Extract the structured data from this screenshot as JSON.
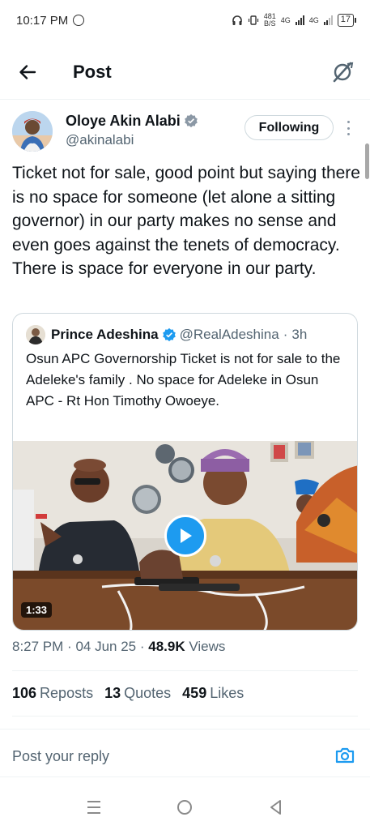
{
  "status_bar": {
    "time": "10:17 PM",
    "net_speed": "481",
    "net_unit": "B/S",
    "network_1": "4G",
    "network_2": "4G",
    "battery": "17"
  },
  "header": {
    "title": "Post",
    "back_icon": "arrow-left-icon",
    "grok_icon": "grok-icon"
  },
  "post": {
    "author_name": "Oloye Akin Alabi",
    "author_handle": "@akinalabi",
    "follow_label": "Following",
    "text": "Ticket not for sale, good point but saying there is no space for someone (let alone a sitting governor) in our party makes no sense and even goes against the tenets of democracy. There is space for everyone in our party.",
    "time": "8:27 PM",
    "date": "04 Jun 25",
    "views_count": "48.9K",
    "views_label": "Views"
  },
  "quote": {
    "author_name": "Prince Adeshina",
    "author_handle": "@RealAdeshina",
    "age": "3h",
    "text": "Osun APC Governorship Ticket is not for sale to the Adeleke's family . No space for Adeleke in Osun APC - Rt Hon Timothy Owoeye.",
    "video_duration": "1:33"
  },
  "stats": {
    "reposts_count": "106",
    "reposts_label": "Reposts",
    "quotes_count": "13",
    "quotes_label": "Quotes",
    "likes_count": "459",
    "likes_label": "Likes"
  },
  "reply": {
    "placeholder": "Post your reply"
  },
  "colors": {
    "accent": "#1d9bf0",
    "text_primary": "#0f1419",
    "text_secondary": "#536471",
    "border": "#cfd9de"
  }
}
